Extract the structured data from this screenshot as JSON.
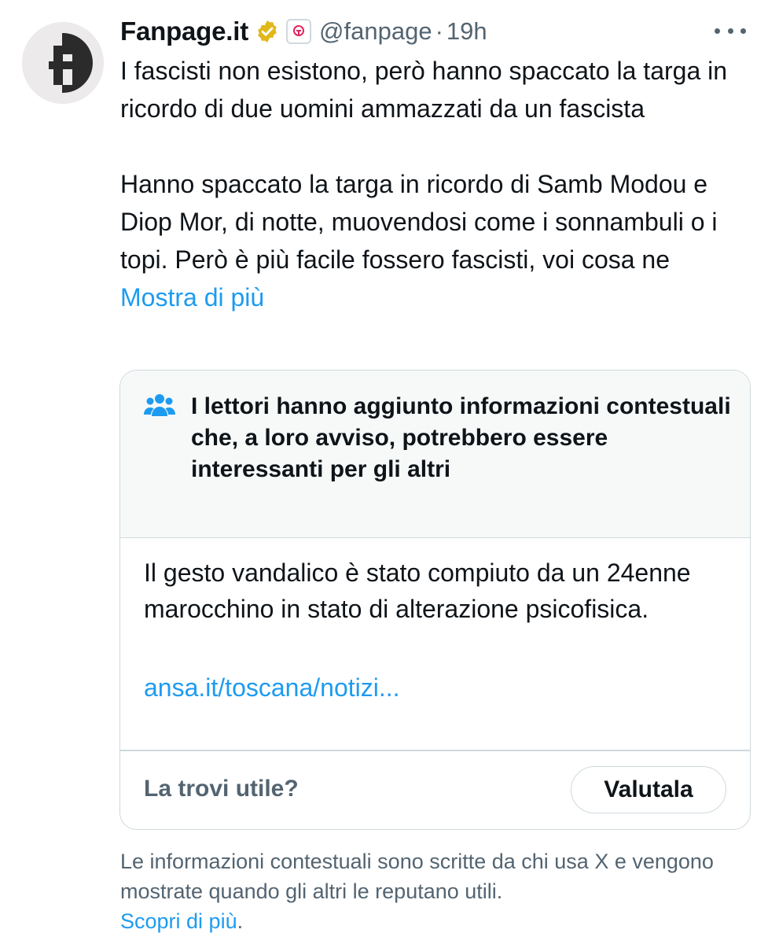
{
  "author": {
    "name": "Fanpage.it",
    "handle": "@fanpage",
    "separator": "·",
    "time": "19h",
    "verified_color": "#e2b719",
    "avatar_icon": "fanpage-logo"
  },
  "tweet": {
    "paragraph1": "I fascisti non esistono, però hanno spaccato la targa in ricordo di due uomini ammazzati da un fascista",
    "paragraph2": "Hanno spaccato la targa in ricordo di Samb Modou e Diop Mor, di notte, muovendosi come i sonnambuli o i topi. Però è più facile fossero fascisti, voi cosa ne",
    "show_more": "Mostra di più"
  },
  "community_note": {
    "icon": "people-icon",
    "title": "I lettori hanno aggiunto informazioni contestuali che, a loro avviso, potrebbero essere interessanti per gli altri",
    "body": "Il gesto vandalico è stato compiuto da un 24enne marocchino in stato di alterazione psicofisica.",
    "link": "ansa.it/toscana/notizi...",
    "question": "La trovi utile?",
    "rate_button": "Valutala"
  },
  "footer": {
    "text": "Le informazioni contestuali sono scritte da chi usa X e vengono mostrate quando gli altri le reputano utili.",
    "learn_more": "Scopri di più",
    "period": "."
  },
  "colors": {
    "link": "#1d9bf0",
    "secondary_text": "#536471",
    "border": "#cfd9de",
    "note_header_bg": "#f7f9f9"
  }
}
